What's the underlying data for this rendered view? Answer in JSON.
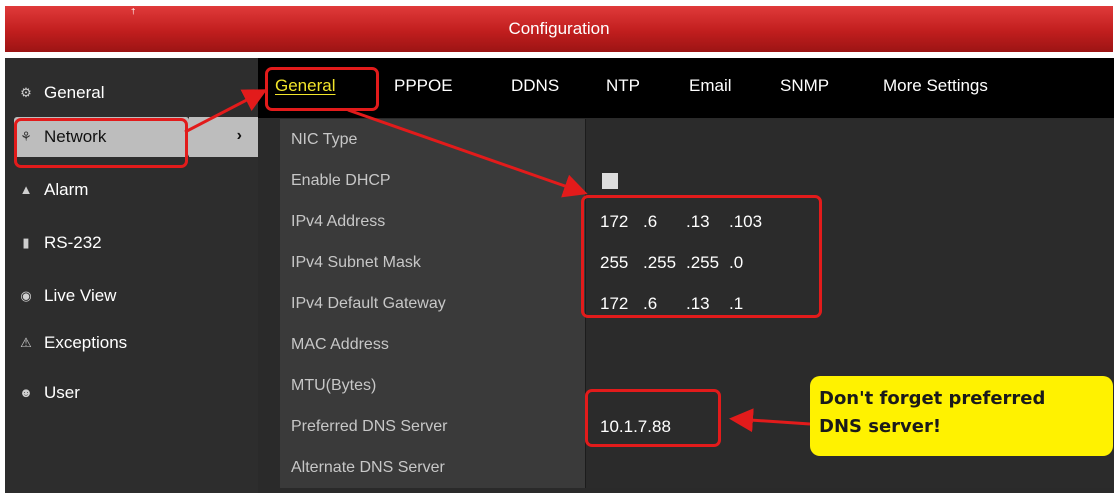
{
  "window": {
    "title": "Configuration",
    "title_mark": "†"
  },
  "sidebar": {
    "items": [
      {
        "label": "General",
        "icon": "gear-icon"
      },
      {
        "label": "Network",
        "icon": "network-icon",
        "chevron": "›"
      },
      {
        "label": "Alarm",
        "icon": "alarm-icon"
      },
      {
        "label": "RS-232",
        "icon": "serial-port-icon"
      },
      {
        "label": "Live View",
        "icon": "eye-icon"
      },
      {
        "label": "Exceptions",
        "icon": "warning-icon"
      },
      {
        "label": "User",
        "icon": "users-icon"
      }
    ]
  },
  "tabs": [
    "General",
    "PPPOE",
    "DDNS",
    "NTP",
    "Email",
    "SNMP",
    "More Settings"
  ],
  "fields": {
    "nic_type": {
      "label": "NIC Type",
      "value": ""
    },
    "enable_dhcp": {
      "label": "Enable DHCP",
      "checked": false
    },
    "ipv4_address": {
      "label": "IPv4 Address",
      "parts": [
        "172",
        ".6",
        ".13",
        ".103"
      ]
    },
    "ipv4_subnet_mask": {
      "label": "IPv4 Subnet Mask",
      "parts": [
        "255",
        ".255",
        ".255",
        ".0"
      ]
    },
    "ipv4_default_gateway": {
      "label": "IPv4 Default Gateway",
      "parts": [
        "172",
        ".6",
        ".13",
        ".1"
      ]
    },
    "mac_address": {
      "label": "MAC Address",
      "value": ""
    },
    "mtu": {
      "label": "MTU(Bytes)",
      "value": ""
    },
    "preferred_dns": {
      "label": "Preferred DNS Server",
      "value": "10.1.7.88"
    },
    "alternate_dns": {
      "label": "Alternate DNS Server",
      "value": ""
    }
  },
  "annotation": {
    "callout_line1": "Don't forget preferred",
    "callout_line2": "DNS server!"
  },
  "colors": {
    "title_bar": "#c11e1e",
    "highlight_box": "#e21b1b",
    "active_tab": "#f2e52a",
    "callout": "#fff200"
  }
}
